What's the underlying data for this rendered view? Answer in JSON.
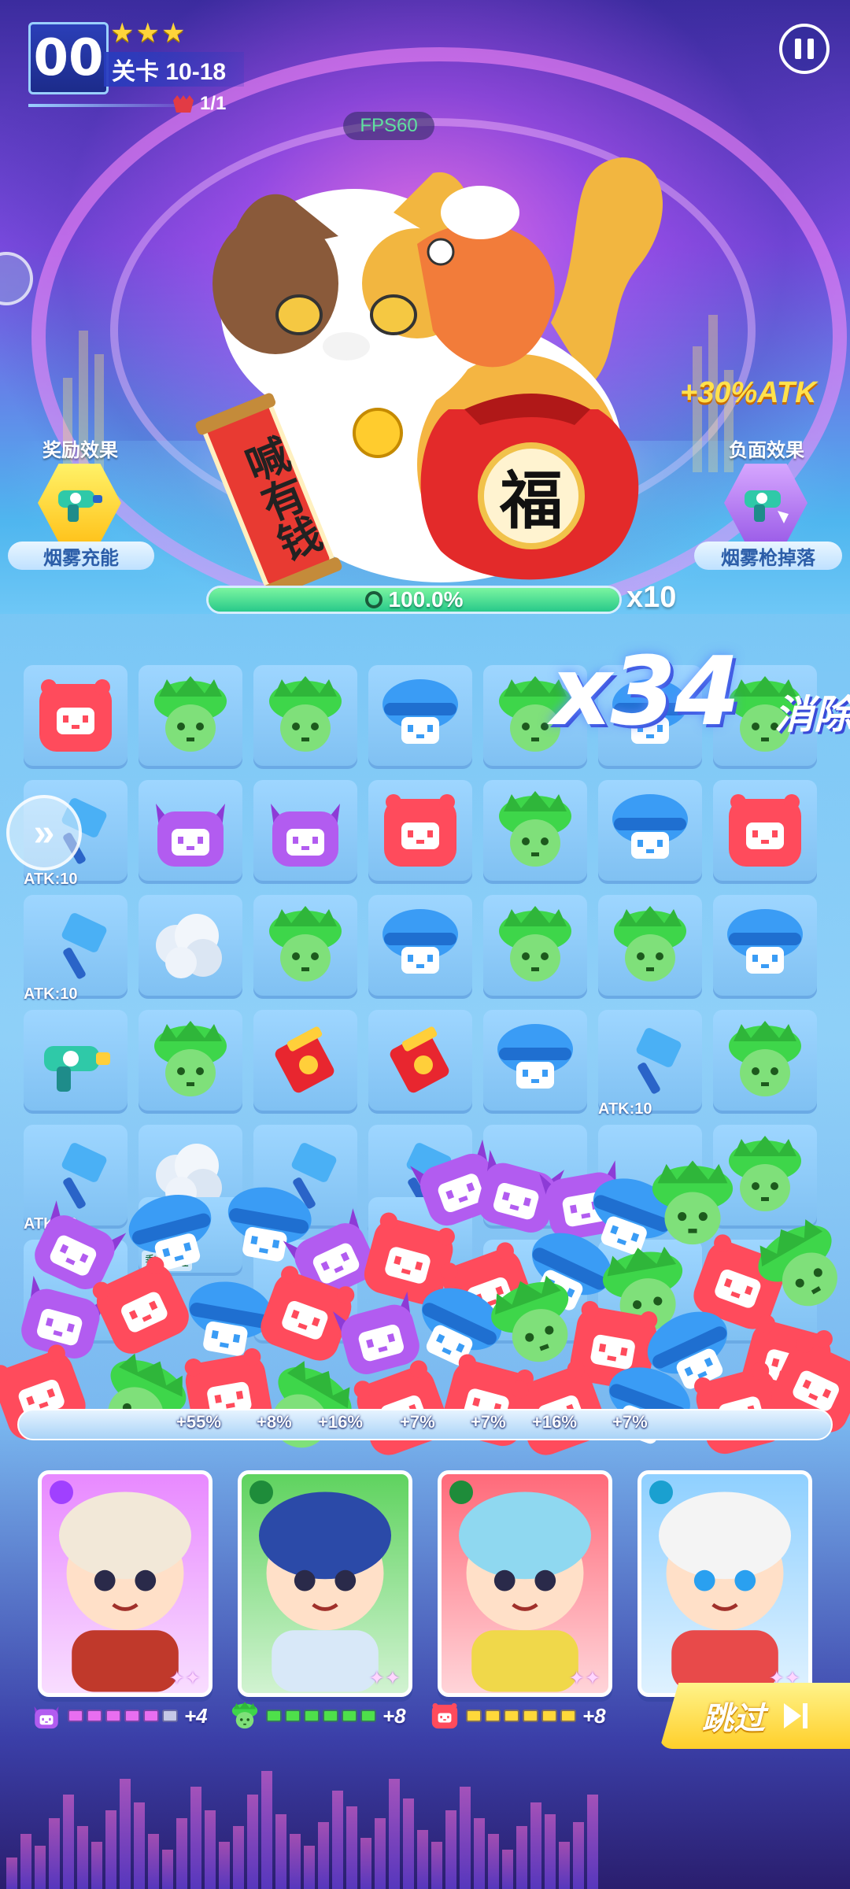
{
  "hud": {
    "level_number": "00",
    "stars": "★★★",
    "level_title": "关卡 10-18",
    "wave": "1/1",
    "fps": "FPS60"
  },
  "icons": {
    "pause": "pause-icon",
    "wave": "crown-icon",
    "speed": "fast-forward-icon",
    "skip": "skip-forward-icon",
    "buff": "smoke-gun-icon",
    "debuff": "smoke-gun-icon"
  },
  "boss": {
    "scroll_text": "喊有钱",
    "bag_text": "福",
    "atk_bonus": "+30%ATK"
  },
  "effects": {
    "reward_title": "奖励效果",
    "reward_label": "烟雾充能",
    "negative_title": "负面效果",
    "negative_label": "烟雾枪掉落"
  },
  "progress": {
    "percent_text": "100.0%",
    "fill_fraction": 1.0,
    "multiplier": "x10"
  },
  "combo": {
    "count": "x34",
    "label": "消除"
  },
  "board": {
    "atk_label": "ATK:10",
    "remain_label": "剩余: 1"
  },
  "bonus_percents": [
    "+55%",
    "+8%",
    "+16%",
    "+7%",
    "+7%",
    "+16%",
    "+7%"
  ],
  "heroes": [
    {
      "name": "skull-warrior",
      "bg": "#e889ff"
    },
    {
      "name": "robed-boy",
      "bg": "#5fd35f"
    },
    {
      "name": "astronaut-bear",
      "bg": "#ff6a7a"
    },
    {
      "name": "headphone-girl",
      "bg": "#8fd0ff"
    }
  ],
  "energy": [
    {
      "color": "#e86ef0",
      "filled": 5,
      "count": "+4"
    },
    {
      "color": "#4ee04a",
      "filled": 6,
      "count": "+8"
    },
    {
      "color": "#ffd83a",
      "filled": 6,
      "count": "+8"
    }
  ],
  "skip": {
    "label": "跳过"
  },
  "colors": {
    "red": "#ff4b5c",
    "green": "#3ed64a",
    "blue": "#3a9cf5",
    "purple": "#b25cf0",
    "accent_yellow": "#ffd43a"
  }
}
